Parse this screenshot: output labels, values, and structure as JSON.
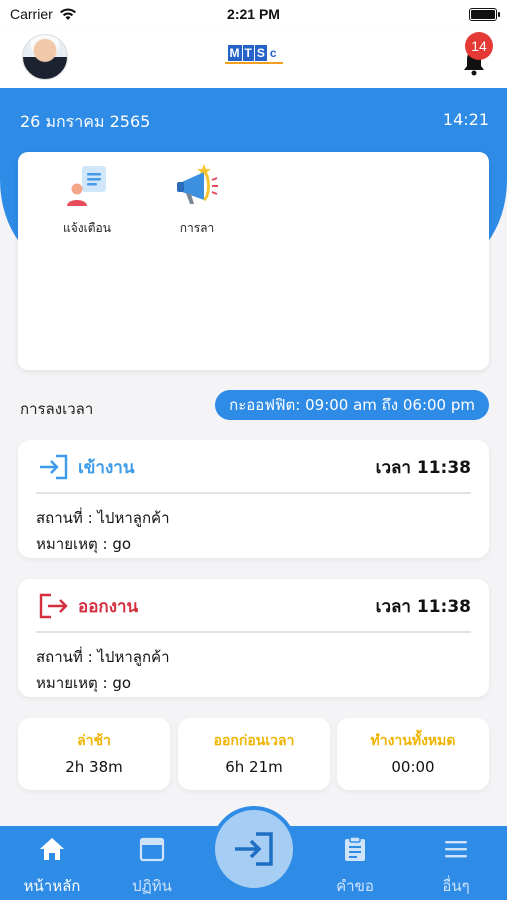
{
  "status_bar": {
    "carrier": "Carrier",
    "time": "2:21 PM"
  },
  "header": {
    "logo_text": [
      "M",
      "T",
      "S",
      "c"
    ],
    "notification_count": "14"
  },
  "band": {
    "date": "26 มกราคม 2565",
    "time": "14:21"
  },
  "menu": [
    {
      "label": "แจ้งเตือน",
      "icon": "notification-icon"
    },
    {
      "label": "การลา",
      "icon": "megaphone-icon"
    }
  ],
  "attendance": {
    "title": "การลงเวลา",
    "office_hours": "กะออฟฟิต: 09:00 am ถึง 06:00 pm",
    "check_in": {
      "label": "เข้างาน",
      "time": "เวลา 11:38",
      "location": "สถานที่ : ไปหาลูกค้า",
      "note": "หมายเหตุ : go"
    },
    "check_out": {
      "label": "ออกงาน",
      "time": "เวลา 11:38",
      "location": "สถานที่ : ไปหาลูกค้า",
      "note": "หมายเหตุ : go"
    }
  },
  "stats": [
    {
      "label": "ล่าช้า",
      "value": "2h 38m"
    },
    {
      "label": "ออกก่อนเวลา",
      "value": "6h 21m"
    },
    {
      "label": "ทำงานทั้งหมด",
      "value": "00:00"
    }
  ],
  "nav": [
    {
      "label": "หน้าหลัก",
      "icon": "home-icon"
    },
    {
      "label": "ปฏิทิน",
      "icon": "calendar-icon"
    },
    {
      "label": "คำขอ",
      "icon": "clipboard-icon"
    },
    {
      "label": "อื่นๆ",
      "icon": "menu-icon"
    }
  ],
  "colors": {
    "primary": "#2e8be6",
    "check_in": "#3d9be9",
    "check_out": "#d32f3f",
    "stat_label": "#f0b400"
  }
}
